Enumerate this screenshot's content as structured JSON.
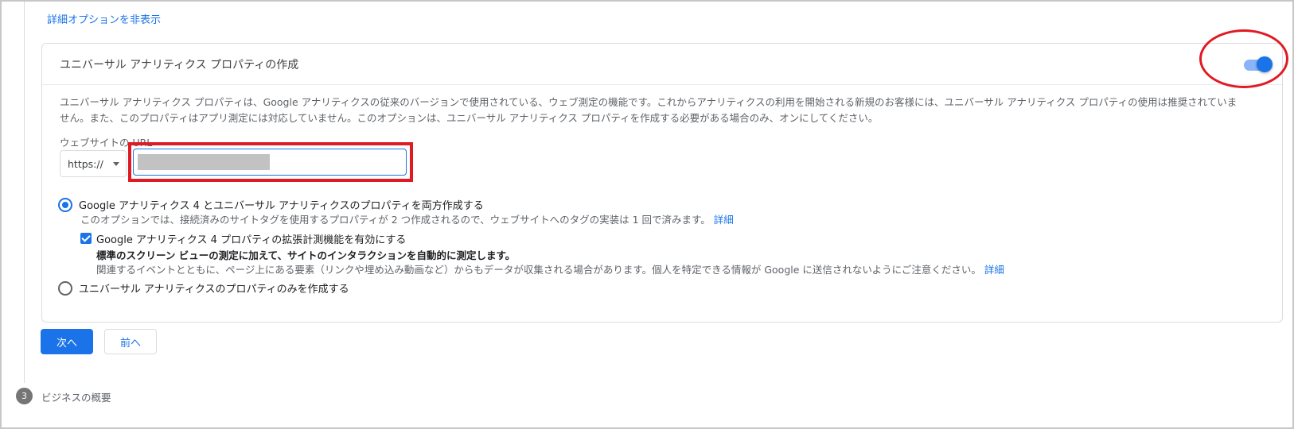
{
  "hide_options_link": "詳細オプションを非表示",
  "card": {
    "title": "ユニバーサル アナリティクス プロパティの作成",
    "toggle_on": true,
    "description_line1": "ユニバーサル アナリティクス プロパティは、Google アナリティクスの従来のバージョンで使用されている、ウェブ測定の機能です。これからアナリティクスの利用を開始される新規のお客様には、ユニバーサル アナリティクス プロパティの使用は推奨されていま",
    "description_line2": "せん。また、このプロパティはアプリ測定には対応していません。このオプションは、ユニバーサル アナリティクス プロパティを作成する必要がある場合のみ、オンにしてください。",
    "url_label": "ウェブサイトの URL",
    "protocol": "https://",
    "url_value": ""
  },
  "options": {
    "both": {
      "label": "Google アナリティクス 4 とユニバーサル アナリティクスのプロパティを両方作成する",
      "sub": "このオプションでは、接続済みのサイトタグを使用するプロパティが 2 つ作成されるので、ウェブサイトへのタグの実装は 1 回で済みます。",
      "link": "詳細",
      "selected": true
    },
    "enhanced": {
      "label": "Google アナリティクス 4 プロパティの拡張計測機能を有効にする",
      "bold_line": "標準のスクリーン ビューの測定に加えて、サイトのインタラクションを自動的に測定します。",
      "sub": "関連するイベントとともに、ページ上にある要素（リンクや埋め込み動画など）からもデータが収集される場合があります。個人を特定できる情報が Google に送信されないようにご注意ください。",
      "link": "詳細",
      "checked": true
    },
    "ua_only": {
      "label": "ユニバーサル アナリティクスのプロパティのみを作成する",
      "selected": false
    }
  },
  "buttons": {
    "next": "次へ",
    "back": "前へ"
  },
  "step": {
    "number": "3",
    "label": "ビジネスの概要"
  },
  "colors": {
    "accent": "#1a73e8",
    "highlight": "#e01a22"
  }
}
